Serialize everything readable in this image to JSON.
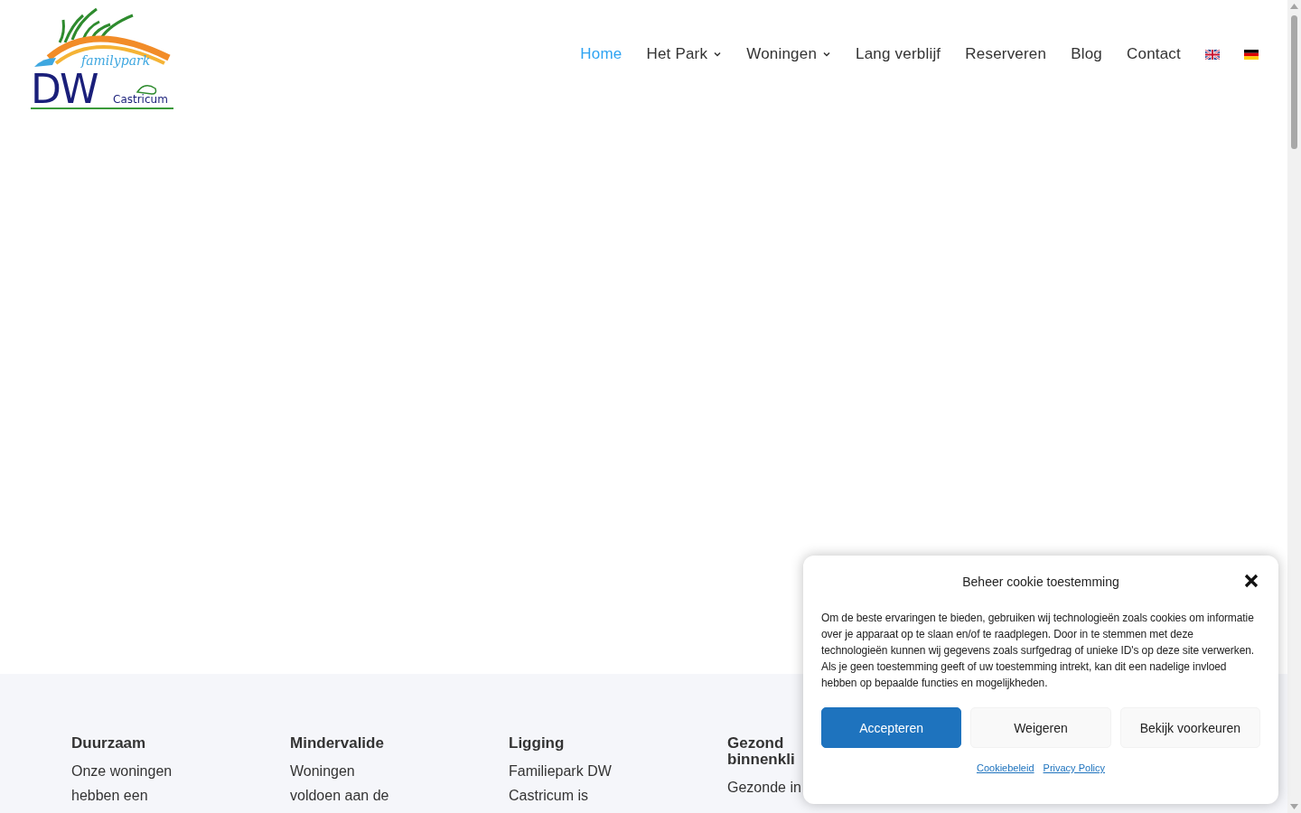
{
  "logo": {
    "tagline": "familypark",
    "initials": "DW",
    "town": "Castricum"
  },
  "nav": {
    "items": [
      {
        "label": "Home",
        "selected": true,
        "has_dropdown": false
      },
      {
        "label": "Het Park",
        "selected": false,
        "has_dropdown": true
      },
      {
        "label": "Woningen",
        "selected": false,
        "has_dropdown": true
      },
      {
        "label": "Lang verblijf",
        "selected": false,
        "has_dropdown": false
      },
      {
        "label": "Reserveren",
        "selected": false,
        "has_dropdown": false
      },
      {
        "label": "Blog",
        "selected": false,
        "has_dropdown": false
      },
      {
        "label": "Contact",
        "selected": false,
        "has_dropdown": false
      }
    ],
    "languages": [
      {
        "kind": "uk"
      },
      {
        "kind": "de"
      }
    ]
  },
  "features": [
    {
      "title": "Duurzaam",
      "text": "Onze woningen hebben een"
    },
    {
      "title": "Mindervalide",
      "text": "Woningen voldoen aan de"
    },
    {
      "title": "Ligging",
      "text": "Familiepark DW Castricum is"
    },
    {
      "title": "Gezond binnenkli",
      "text": "Gezonde in"
    }
  ],
  "cookie_dialog": {
    "title": "Beheer cookie toestemming",
    "body": "Om de beste ervaringen te bieden, gebruiken wij technologieën zoals cookies om informatie over je apparaat op te slaan en/of te raadplegen. Door in te stemmen met deze technologieën kunnen wij gegevens zoals surfgedrag of unieke ID's op deze site verwerken. Als je geen toestemming geeft of uw toestemming intrekt, kan dit een nadelige invloed hebben op bepaalde functies en mogelijkheden.",
    "buttons": [
      {
        "label": "Accepteren",
        "kind": "primary"
      },
      {
        "label": "Weigeren",
        "kind": "secondary"
      },
      {
        "label": "Bekijk voorkeuren",
        "kind": "secondary"
      }
    ],
    "links": [
      "Cookiebeleid",
      "Privacy Policy"
    ]
  }
}
